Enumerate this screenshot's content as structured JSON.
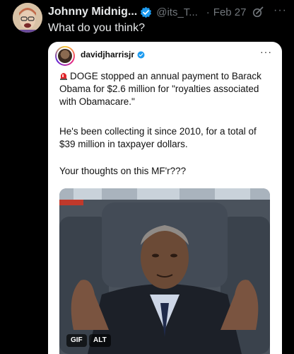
{
  "tweet": {
    "author_name": "Johnny Midnig...",
    "author_handle": "@its_T...",
    "separator": "·",
    "date": "Feb 27",
    "more_glyph": "···",
    "text": "What do you think?"
  },
  "embed": {
    "username": "davidjharrisjr",
    "more_glyph": "···",
    "paragraph_1": "DOGE stopped an annual payment to Barack Obama for $2.6 million for \"royalties associated with Obamacare.\"",
    "paragraph_2": "He's been collecting it since 2010, for a total of $39 million in taxpayer dollars.",
    "paragraph_3": "Your thoughts on this MF'r???",
    "media": {
      "gif_label": "GIF",
      "alt_label": "ALT"
    }
  },
  "colors": {
    "background": "#000000",
    "primary_text": "#e7e9ea",
    "secondary_text": "#71767b",
    "verified_blue": "#1d9bf0",
    "card_background": "#ffffff"
  },
  "icons": [
    "verified-badge-icon",
    "edit-history-icon",
    "more-icon",
    "siren-icon"
  ]
}
